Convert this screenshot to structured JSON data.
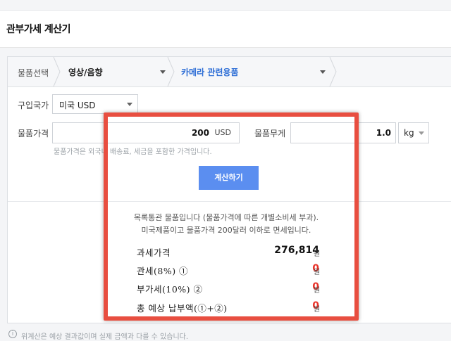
{
  "page": {
    "title": "관부가세 계산기"
  },
  "category": {
    "label": "물품선택",
    "main": "영상/음향",
    "sub": "카메라 관련용품"
  },
  "form": {
    "country_label": "구입국가",
    "country_value": "미국 USD",
    "price_label": "물품가격",
    "price_value": "200",
    "price_unit": "USD",
    "weight_label": "물품무게",
    "weight_value": "1.0",
    "weight_unit": "kg",
    "hint": "물품가격은 외국내 배송료, 세금을 포함한 가격입니다.",
    "calc_button": "계산하기"
  },
  "result": {
    "message_line1": "목록통관 물품입니다 (물품가격에 따른 개별소비세 부과).",
    "message_line2": "미국제품이고 물품가격 200달러 이하로 면세입니다.",
    "rows": [
      {
        "label": "과세가격",
        "value": "276,814",
        "unit": "원",
        "color": "#111111"
      },
      {
        "label": "관세(8%) ①",
        "value": "0",
        "unit": "원",
        "color": "#e8332a"
      },
      {
        "label": "부가세(10%) ②",
        "value": "0",
        "unit": "원",
        "color": "#e8332a"
      },
      {
        "label": "총 예상 납부액(①+②)",
        "value": "0",
        "unit": "원",
        "color": "#e8332a"
      }
    ]
  },
  "footnote": "위계산은 예상 결과값이며 실제 금액과 다를 수 있습니다."
}
